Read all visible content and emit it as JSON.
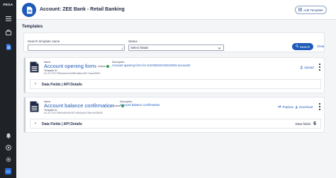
{
  "rail": {
    "brand": "PEGA",
    "avatar_initials": "AA"
  },
  "header": {
    "title": "Account: ZEE Bank - Retail Banking",
    "add_button_label": "Add Template"
  },
  "templates": {
    "section_title": "Templates",
    "filter": {
      "name_label": "Search template name",
      "name_value": "",
      "status_label": "Status",
      "status_value": "Select Status",
      "search_label": "Search",
      "clear_label": "Clear"
    },
    "cards": [
      {
        "name_label": "Name",
        "name": "Account opening form",
        "status": "Active",
        "id_label": "Template ID",
        "id": "AC-6T7191735bbaeee1b40ff5cfa8ea1561 0aaa4950f1",
        "desc_label": "Description",
        "desc": "Account opening form for SAVINGS/CHECKING accounts",
        "upload_label": "Upload",
        "data_fields_label": "Data Fields | API Details"
      },
      {
        "name_label": "Name",
        "name": "Account balance confirmation",
        "status": "Active",
        "id_label": "Template ID",
        "id": "AC-6T7191735f49a5403b36714ff52a4b4739e1e6325f36",
        "desc_label": "Description",
        "desc": "Account balance confirmation",
        "replace_label": "Replace",
        "download_label": "Download",
        "data_fields_label": "Data Fields | API Details",
        "data_fields_count_label": "Data fields:",
        "data_fields_count": "6"
      }
    ]
  },
  "colors": {
    "accent": "#1d5ab9",
    "rail": "#1f2327",
    "active": "#2f9e44"
  }
}
